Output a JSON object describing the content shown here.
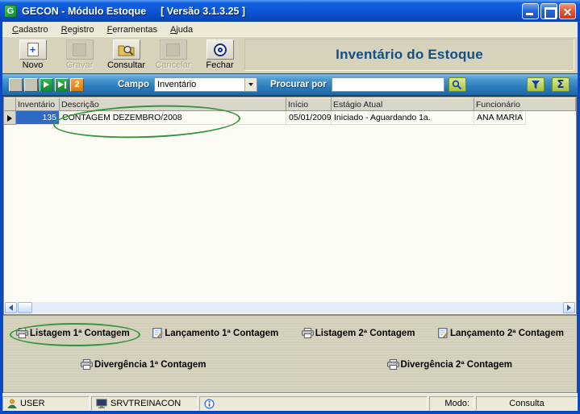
{
  "window": {
    "title": "GECON - Módulo Estoque",
    "version": "[ Versão 3.1.3.25 ]",
    "icon_letter": "G"
  },
  "menu": {
    "items": [
      "Cadastro",
      "Registro",
      "Ferramentas",
      "Ajuda"
    ]
  },
  "toolbar": {
    "buttons": [
      {
        "label": "Novo",
        "icon": "new-record-icon",
        "enabled": true
      },
      {
        "label": "Gravar",
        "icon": "save-icon",
        "enabled": false
      },
      {
        "label": "Consultar",
        "icon": "folder-search-icon",
        "enabled": true
      },
      {
        "label": "Cancelar",
        "icon": "cancel-icon",
        "enabled": false
      },
      {
        "label": "Fechar",
        "icon": "power-circle-icon",
        "enabled": true
      }
    ],
    "page_title": "Inventário do Estoque"
  },
  "navbar": {
    "campo_label": "Campo",
    "campo_value": "Inventário",
    "procurar_label": "Procurar por",
    "procurar_value": "",
    "record_count": "2",
    "sigma_glyph": "Σ"
  },
  "table": {
    "columns": [
      "Inventário",
      "Descrição",
      "Início",
      "Estágio Atual",
      "Funcionário"
    ],
    "rows": [
      {
        "inventario": "135",
        "descricao": "CONTAGEM DEZEMBRO/2008",
        "inicio": "05/01/2009",
        "estagio": "Iniciado - Aguardando 1a.",
        "funcionario": "ANA MARIA"
      }
    ]
  },
  "actions": {
    "row1": [
      {
        "label": "Listagem 1ª Contagem",
        "icon": "printer-icon"
      },
      {
        "label": "Lançamento 1ª Contagem",
        "icon": "document-edit-icon"
      },
      {
        "label": "Listagem 2ª Contagem",
        "icon": "printer-icon"
      },
      {
        "label": "Lançamento 2ª Contagem",
        "icon": "document-edit-icon"
      }
    ],
    "row2": [
      {
        "label": "Divergência 1ª Contagem",
        "icon": "printer-icon"
      },
      {
        "label": "Divergência 2ª Contagem",
        "icon": "printer-icon"
      }
    ]
  },
  "statusbar": {
    "user": "USER",
    "server": "SRVTREINACON",
    "modo_label": "Modo:",
    "modo_value": "Consulta"
  },
  "colors": {
    "titlebar_blue": "#0c55d6",
    "selection_blue": "#316ac5",
    "panel_tan": "#d6d2bc",
    "navbar_blue": "#2d7cba",
    "page_title_blue": "#154f80",
    "annotation_green": "#35953f"
  }
}
